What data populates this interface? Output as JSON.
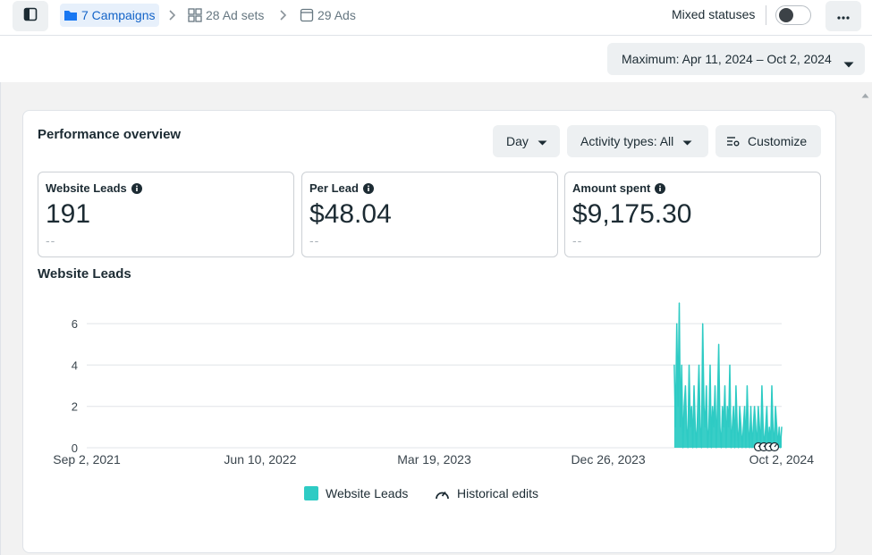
{
  "breadcrumb": {
    "campaigns": "7 Campaigns",
    "ad_sets": "28 Ad sets",
    "ads": "29 Ads"
  },
  "status": {
    "label": "Mixed statuses"
  },
  "date_range": {
    "label": "Maximum: Apr 11, 2024 – Oct 2, 2024"
  },
  "performance": {
    "title": "Performance overview",
    "day_button": "Day",
    "activity_button": "Activity types: All",
    "customize_button": "Customize",
    "metrics": [
      {
        "label": "Website Leads",
        "value": "191",
        "compare": "--"
      },
      {
        "label": "Per Lead",
        "value": "$48.04",
        "compare": "--"
      },
      {
        "label": "Amount spent",
        "value": "$9,175.30",
        "compare": "--"
      }
    ],
    "chart_title": "Website Leads"
  },
  "chart_data": {
    "type": "line",
    "title": "Website Leads",
    "x_tick_labels": [
      "Sep 2, 2021",
      "Jun 10, 2022",
      "Mar 19, 2023",
      "Dec 26, 2023",
      "Oct 2, 2024"
    ],
    "y_ticks": [
      0,
      2,
      4,
      6
    ],
    "ylim": [
      0,
      7
    ],
    "grid": true,
    "legend_placement": "bottom",
    "series": [
      {
        "name": "Website Leads",
        "color": "#2ecbc4",
        "x": [
          "2024-04-11",
          "2024-04-13",
          "2024-04-15",
          "2024-04-17",
          "2024-04-19",
          "2024-04-21",
          "2024-04-23",
          "2024-04-25",
          "2024-04-27",
          "2024-04-29",
          "2024-05-01",
          "2024-05-03",
          "2024-05-05",
          "2024-05-07",
          "2024-05-09",
          "2024-05-11",
          "2024-05-13",
          "2024-05-15",
          "2024-05-17",
          "2024-05-19",
          "2024-05-21",
          "2024-05-23",
          "2024-05-25",
          "2024-05-27",
          "2024-05-29",
          "2024-05-31",
          "2024-06-02",
          "2024-06-04",
          "2024-06-06",
          "2024-06-08",
          "2024-06-10",
          "2024-06-12",
          "2024-06-14",
          "2024-06-16",
          "2024-06-18",
          "2024-06-20",
          "2024-06-22",
          "2024-06-24",
          "2024-06-26",
          "2024-06-28",
          "2024-06-30",
          "2024-07-02",
          "2024-07-04",
          "2024-07-06",
          "2024-07-08",
          "2024-07-10",
          "2024-07-12",
          "2024-07-14",
          "2024-07-16",
          "2024-07-18",
          "2024-07-20",
          "2024-07-22",
          "2024-07-24",
          "2024-07-26",
          "2024-07-28",
          "2024-07-30",
          "2024-08-01",
          "2024-08-03",
          "2024-08-05",
          "2024-08-07",
          "2024-08-09",
          "2024-08-11",
          "2024-08-13",
          "2024-08-15",
          "2024-08-17",
          "2024-08-19",
          "2024-08-21",
          "2024-08-23",
          "2024-08-25",
          "2024-08-27",
          "2024-08-29",
          "2024-08-31",
          "2024-09-02",
          "2024-09-04",
          "2024-09-06",
          "2024-09-08",
          "2024-09-10",
          "2024-09-12",
          "2024-09-14",
          "2024-09-16",
          "2024-09-18",
          "2024-09-20",
          "2024-09-22",
          "2024-09-24",
          "2024-09-26",
          "2024-09-28",
          "2024-09-30",
          "2024-10-02"
        ],
        "values": [
          4,
          1,
          6,
          2,
          7,
          1,
          4,
          0,
          2,
          3,
          1,
          0,
          4,
          1,
          2,
          0,
          3,
          1,
          0,
          2,
          4,
          1,
          0,
          6,
          2,
          1,
          3,
          0,
          1,
          4,
          0,
          2,
          1,
          3,
          0,
          2,
          5,
          1,
          0,
          2,
          1,
          3,
          0,
          2,
          1,
          4,
          0,
          1,
          2,
          0,
          3,
          1,
          0,
          2,
          1,
          0,
          1,
          2,
          0,
          3,
          1,
          0,
          2,
          0,
          1,
          2,
          1,
          0,
          2,
          1,
          0,
          3,
          1,
          0,
          1,
          2,
          0,
          1,
          0,
          3,
          1,
          0,
          2,
          1,
          0,
          1,
          0,
          1
        ]
      }
    ],
    "historical_edits_label": "Historical edits"
  }
}
